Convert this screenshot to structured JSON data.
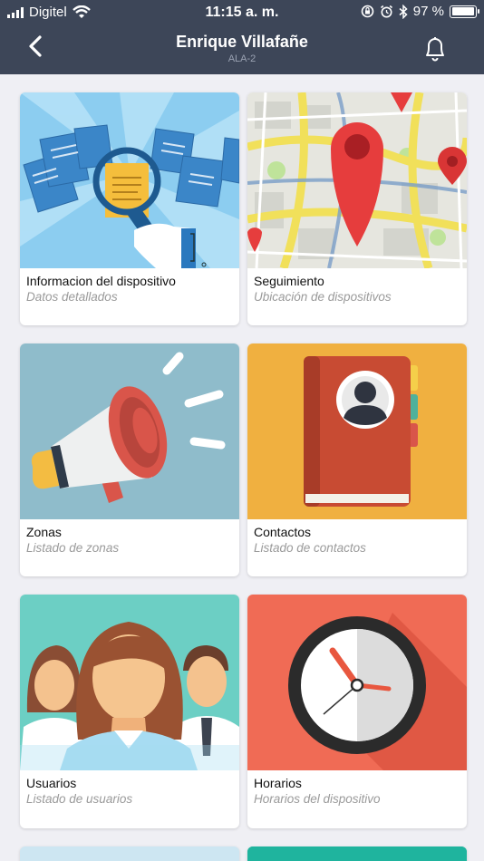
{
  "status_bar": {
    "carrier": "Digitel",
    "time": "11:15 a. m.",
    "battery": "97 %",
    "battery_level": 0.97,
    "icons": [
      "signal-icon",
      "wifi-icon",
      "orientation-lock-icon",
      "alarm-icon",
      "bluetooth-icon",
      "battery-icon"
    ]
  },
  "header": {
    "title": "Enrique Villafañe",
    "subtitle": "ALA-2",
    "background": "#3d4658",
    "icons": [
      "back-chevron-icon",
      "bell-icon"
    ]
  },
  "cards": [
    {
      "label": "Informacion del dispositivo",
      "desc": "Datos detallados",
      "icon": "document-search-icon"
    },
    {
      "label": "Seguimiento",
      "desc": "Ubicación de dispositivos",
      "icon": "map-pin-icon"
    },
    {
      "label": "Zonas",
      "desc": "Listado de zonas",
      "icon": "megaphone-icon"
    },
    {
      "label": "Contactos",
      "desc": "Listado de contactos",
      "icon": "address-book-icon"
    },
    {
      "label": "Usuarios",
      "desc": "Listado de usuarios",
      "icon": "users-icon"
    },
    {
      "label": "Horarios",
      "desc": "Horarios del dispositivo",
      "icon": "clock-icon"
    }
  ],
  "colors": {
    "page_background": "#efeff4",
    "card_info": "#7cc0e8",
    "card_map": "#e8e8e2",
    "card_zones": "#8fbccb",
    "card_contacts": "#f0b040",
    "card_users": "#6ccfc4",
    "card_schedule": "#f06b55"
  }
}
